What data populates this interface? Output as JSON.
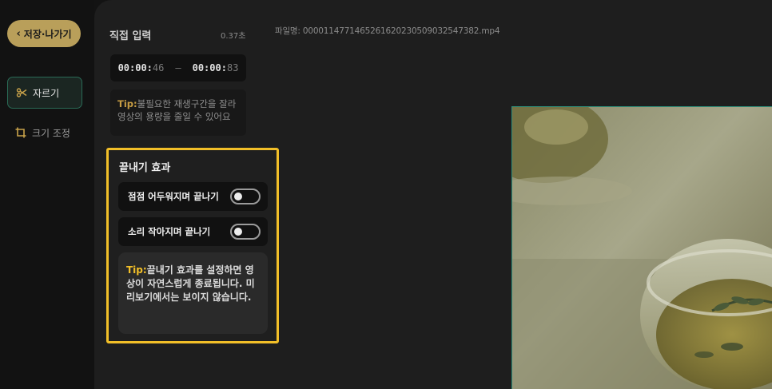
{
  "sidebar": {
    "back_label": "저장·나가기",
    "tools": [
      {
        "label": "자르기",
        "icon": "scissors-icon",
        "active": true
      },
      {
        "label": "크기 조정",
        "icon": "crop-icon",
        "active": false
      }
    ]
  },
  "trim": {
    "title": "직접 입력",
    "duration": "0.37초",
    "start_main": "00:00:",
    "start_frac": "46",
    "separator": "–",
    "end_main": "00:00:",
    "end_frac": "83",
    "tip_label": "Tip:",
    "tip_text": "불필요한 재생구간을 잘라 영상의 용량을 줄일 수 있어요"
  },
  "file": {
    "name": "파일명: 000011477146526162023050903254738​2.mp4"
  },
  "end_effect": {
    "title": "끝내기 효과",
    "options": [
      {
        "label": "점점 어두워지며 끝나기",
        "on": false
      },
      {
        "label": "소리 작아지며 끝나기",
        "on": false
      }
    ],
    "tip_label": "Tip:",
    "tip_text": "끝내기 효과를 설정하면 영상이 자연스럽게 종료됩니다. 미리보기에서는 보이지 않습니다."
  },
  "colors": {
    "accent_gold": "#b99f5a",
    "highlight_yellow": "#f2bf28",
    "active_green": "#2a6b56"
  }
}
